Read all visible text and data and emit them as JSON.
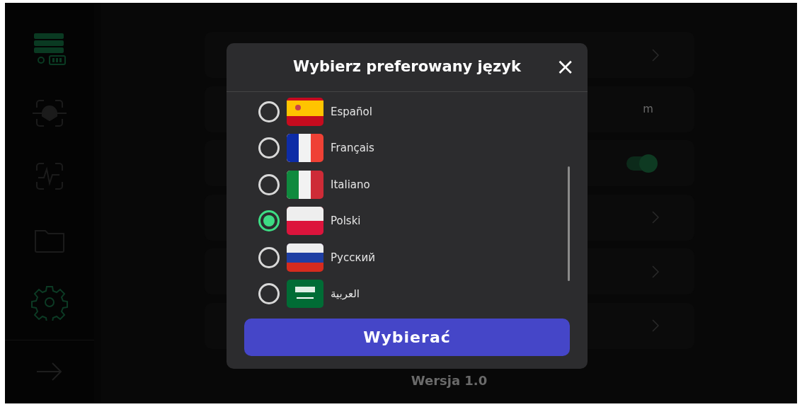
{
  "sidebar": {
    "items": [
      {
        "selected": false
      },
      {
        "selected": false
      },
      {
        "selected": false
      },
      {
        "selected": true
      }
    ]
  },
  "settings_rows": [
    {
      "kind": "link"
    },
    {
      "kind": "value",
      "value": "m"
    },
    {
      "kind": "toggle",
      "on": true
    },
    {
      "kind": "link"
    },
    {
      "kind": "link"
    },
    {
      "kind": "link"
    }
  ],
  "footer": {
    "version": "Wersja 1.0"
  },
  "dialog": {
    "title": "Wybierz preferowany język",
    "close": "×",
    "languages": [
      {
        "label": "Español",
        "selected": false
      },
      {
        "label": "Français",
        "selected": false
      },
      {
        "label": "Italiano",
        "selected": false
      },
      {
        "label": "Polski",
        "selected": true
      },
      {
        "label": "Русский",
        "selected": false
      },
      {
        "label": "العربية",
        "selected": false
      }
    ],
    "button": "Wybierać"
  }
}
